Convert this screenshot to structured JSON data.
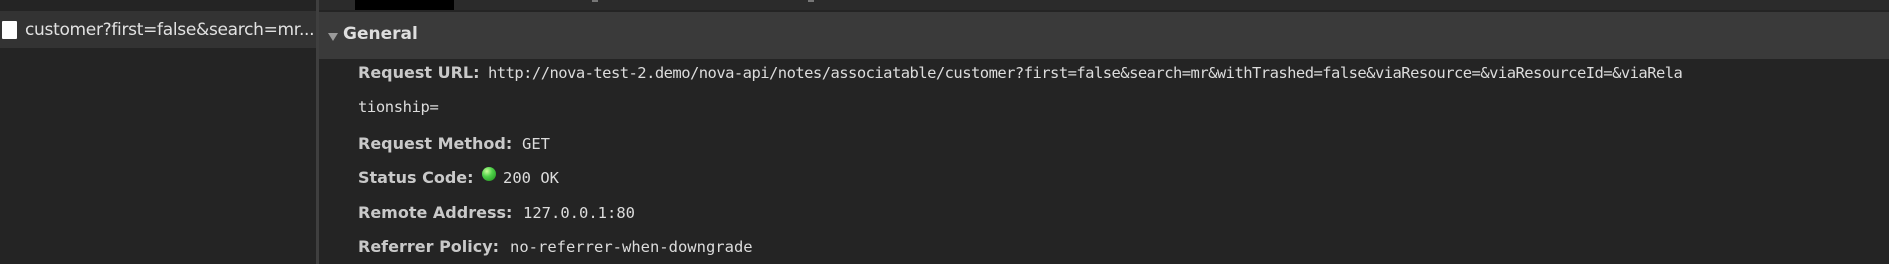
{
  "request_list": {
    "selected_item": {
      "icon": "document-icon",
      "name": "customer?first=false&search=mr..."
    }
  },
  "general": {
    "title": "General",
    "request_url_label": "Request URL:",
    "request_url_value": "http://nova-test-2.demo/nova-api/notes/associatable/customer?first=false&search=mr&withTrashed=false&viaResource=&viaResourceId=&viaRela",
    "request_url_value_cont": "tionship=",
    "request_method_label": "Request Method:",
    "request_method_value": "GET",
    "status_code_label": "Status Code:",
    "status_code_value": "200 OK",
    "status_color": "#3cc43a",
    "remote_address_label": "Remote Address:",
    "remote_address_value": "127.0.0.1:80",
    "referrer_policy_label": "Referrer Policy:",
    "referrer_policy_value": "no-referrer-when-downgrade"
  }
}
